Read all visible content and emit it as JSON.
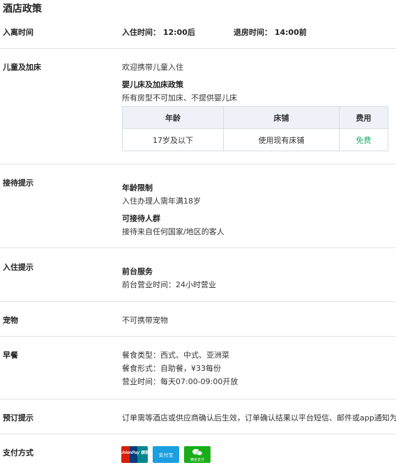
{
  "page_title": "酒店政策",
  "checkin_time": {
    "label": "入离时间",
    "checkin": "入住时间： 12:00后",
    "checkout": "退房时间： 14:00前"
  },
  "children": {
    "label": "儿童及加床",
    "welcome": "欢迎携带儿童入住",
    "crib_title": "婴儿床及加床政策",
    "crib_desc": "所有房型不可加床、不提供婴儿床",
    "table": {
      "headers": [
        "年龄",
        "床铺",
        "费用"
      ],
      "rows": [
        [
          "17岁及以下",
          "使用现有床铺",
          "免费"
        ]
      ]
    }
  },
  "reception": {
    "label": "接待提示",
    "age_title": "年龄限制",
    "age_desc": "入住办理人需年满18岁",
    "guests_title": "可接待人群",
    "guests_desc": "接待来自任何国家/地区的客人"
  },
  "checkin_tips": {
    "label": "入住提示",
    "desk_title": "前台服务",
    "desk_desc": "前台营业时间：24小时营业"
  },
  "pets": {
    "label": "宠物",
    "desc": "不可携带宠物"
  },
  "breakfast": {
    "label": "早餐",
    "type": "餐食类型：西式、中式、亚洲菜",
    "form": "餐食形式：自助餐，¥33每份",
    "hours": "营业时间：每天07:00-09:00开放"
  },
  "booking": {
    "label": "预订提示",
    "desc": "订单需等酒店或供应商确认后生效，订单确认结果以平台短信、邮件或app通知为准。"
  },
  "payment": {
    "label": "支付方式",
    "methods": [
      "UnionPay 银联",
      "支付宝",
      "微信支付"
    ],
    "colors": {
      "unionpay": "#d81e06",
      "alipay": "#1a9fe0",
      "wechat": "#1aad19"
    }
  }
}
